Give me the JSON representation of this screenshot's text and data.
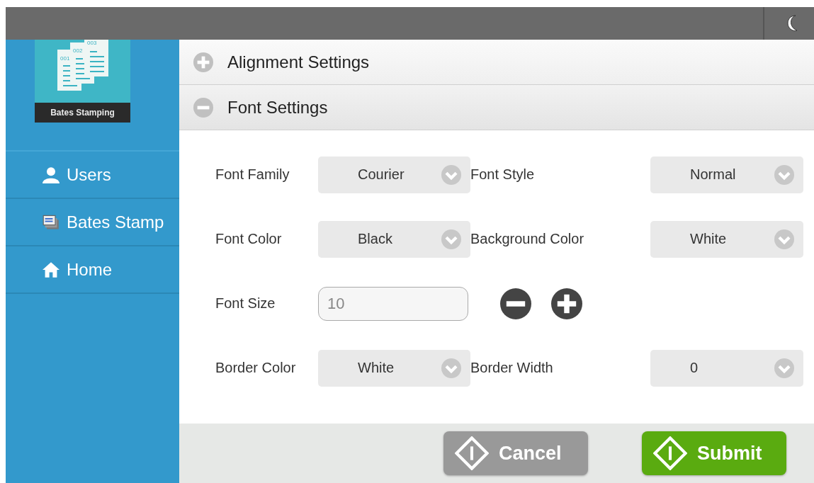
{
  "logo": {
    "page_numbers": [
      "001",
      "002",
      "003"
    ],
    "caption": "Bates Stamping"
  },
  "sidebar": {
    "items": [
      {
        "label": "Users",
        "kind": "user",
        "selected": false
      },
      {
        "label": "Bates Stamp",
        "kind": "stamp",
        "selected": false
      },
      {
        "label": "Home",
        "kind": "home",
        "selected": false
      }
    ]
  },
  "sections": [
    {
      "title": "Alignment Settings",
      "expanded": false
    },
    {
      "title": "Font Settings",
      "expanded": true
    }
  ],
  "fields": [
    {
      "kind": "select",
      "label": "Font Family",
      "value": "Courier"
    },
    {
      "kind": "select",
      "label": "Font Style",
      "value": "Normal"
    },
    {
      "kind": "select",
      "label": "Font Color",
      "value": "Black"
    },
    {
      "kind": "select",
      "label": "Background Color",
      "value": "White"
    },
    {
      "kind": "number",
      "label": "Font Size",
      "placeholder": "10"
    },
    {
      "kind": "select",
      "label": "Border Color",
      "value": "White"
    },
    {
      "kind": "select",
      "label": "Border Width",
      "value": "0"
    }
  ],
  "buttons": [
    {
      "label": "Cancel",
      "kind": "secondary"
    },
    {
      "label": "Submit",
      "kind": "primary"
    }
  ]
}
